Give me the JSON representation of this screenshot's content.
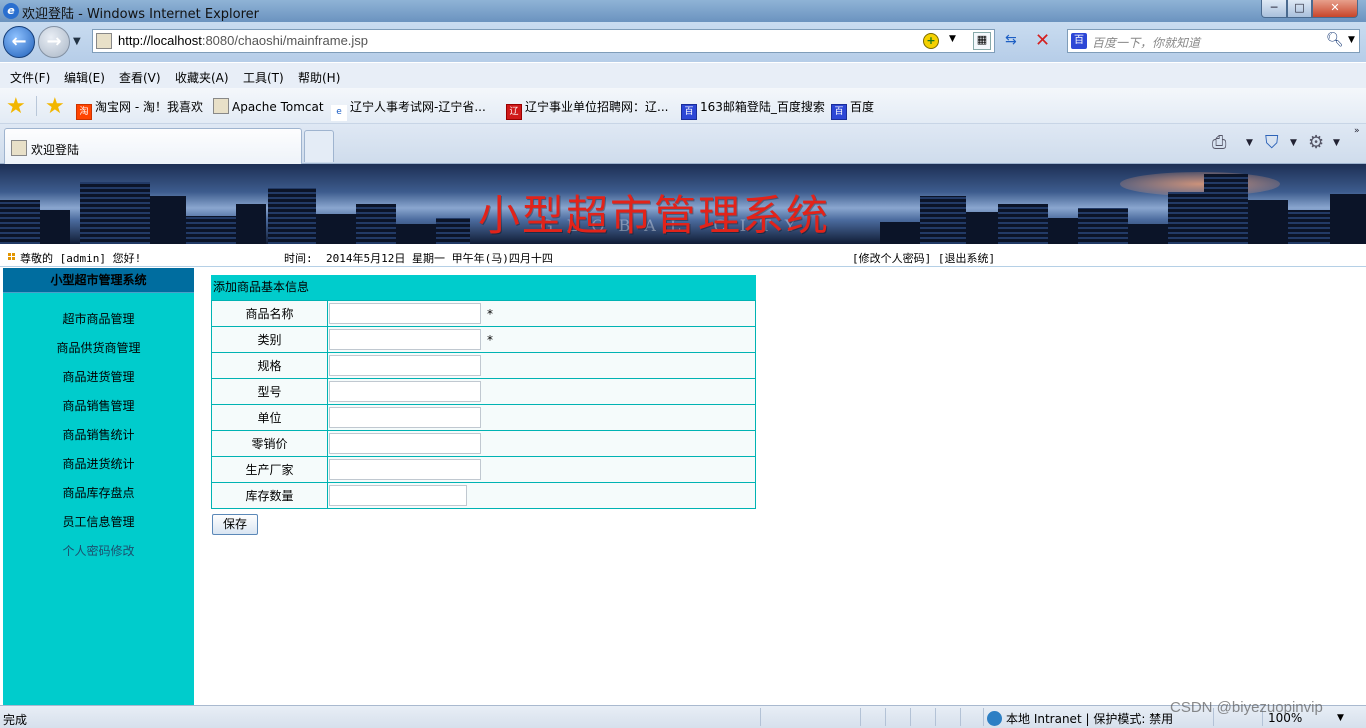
{
  "window": {
    "title": "欢迎登陆 - Windows Internet Explorer",
    "minimize": "─",
    "maximize": "□",
    "close": "✕"
  },
  "nav": {
    "back": "←",
    "forward": "→",
    "url_host": "http://localhost",
    "url_rest": ":8080/chaoshi/mainframe.jsp",
    "search_placeholder": "百度一下，你就知道",
    "refresh": "⇆",
    "stop": "✕",
    "search_icon": "🔍︎"
  },
  "menu": [
    "文件(F)",
    "编辑(E)",
    "查看(V)",
    "收藏夹(A)",
    "工具(T)",
    "帮助(H)"
  ],
  "favorites": [
    {
      "label": "淘宝网 - 淘！我喜欢",
      "icon": "淘"
    },
    {
      "label": "Apache Tomcat",
      "icon": ""
    },
    {
      "label": "辽宁人事考试网-辽宁省...",
      "icon": "e"
    },
    {
      "label": "辽宁事业单位招聘网：辽...",
      "icon": "辽"
    },
    {
      "label": "163邮箱登陆_百度搜索",
      "icon": "百"
    },
    {
      "label": "百度",
      "icon": "百"
    }
  ],
  "tab": {
    "label": "欢迎登陆"
  },
  "banner": {
    "title": "小型超市管理系统",
    "ghost_text": "GLOBAL CITY"
  },
  "infobar": {
    "greeting": "尊敬的 [admin] 您好!",
    "time_label": "时间:",
    "time_value": "2014年5月12日 星期一 甲午年(马)四月十四",
    "links": "[修改个人密码] [退出系统]"
  },
  "sidebar": {
    "header": "小型超市管理系统",
    "items": [
      "超市商品管理",
      "商品供货商管理",
      "商品进货管理",
      "商品销售管理",
      "商品销售统计",
      "商品进货统计",
      "商品库存盘点",
      "员工信息管理",
      "个人密码修改"
    ]
  },
  "form": {
    "title": "添加商品基本信息",
    "fields": [
      {
        "label": "商品名称",
        "value": "",
        "required": "*"
      },
      {
        "label": "类别",
        "value": "",
        "required": "*"
      },
      {
        "label": "规格",
        "value": "",
        "required": ""
      },
      {
        "label": "型号",
        "value": "",
        "required": ""
      },
      {
        "label": "单位",
        "value": "",
        "required": ""
      },
      {
        "label": "零销价",
        "value": "",
        "required": ""
      },
      {
        "label": "生产厂家",
        "value": "",
        "required": ""
      },
      {
        "label": "库存数量",
        "value": "",
        "required": ""
      }
    ],
    "save_label": "保存"
  },
  "status": {
    "done": "完成",
    "zone": "本地 Intranet | 保护模式: 禁用",
    "zoom": "100%"
  },
  "watermark": "CSDN @biyezuopinvip"
}
